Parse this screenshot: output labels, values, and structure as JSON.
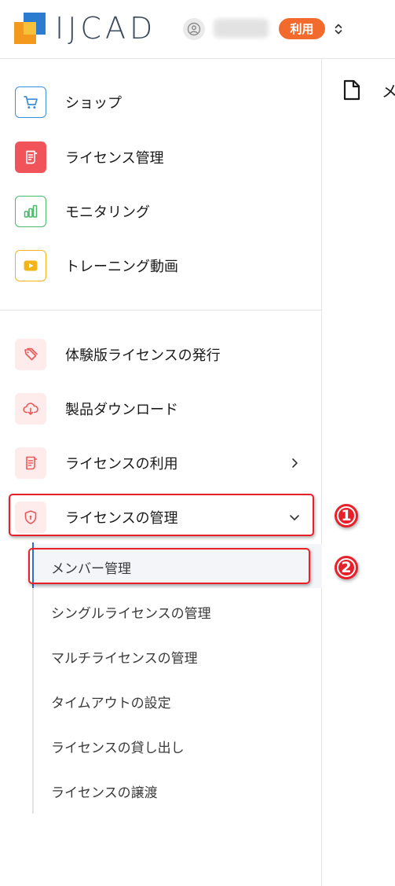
{
  "header": {
    "logo_text": "IJCAD",
    "badge": "利用",
    "logo_colors": {
      "blue": "#2b7bd0",
      "orange": "#f39a1e"
    }
  },
  "nav_primary": [
    {
      "label": "ショップ",
      "icon": "cart-icon"
    },
    {
      "label": "ライセンス管理",
      "icon": "document-icon"
    },
    {
      "label": "モニタリング",
      "icon": "bar-chart-icon"
    },
    {
      "label": "トレーニング動画",
      "icon": "play-icon"
    }
  ],
  "nav_secondary": [
    {
      "label": "体験版ライセンスの発行",
      "icon": "tags-icon"
    },
    {
      "label": "製品ダウンロード",
      "icon": "cloud-download-icon"
    },
    {
      "label": "ライセンスの利用",
      "icon": "document-icon"
    },
    {
      "label": "ライセンスの管理",
      "icon": "shield-icon",
      "expanded": true
    }
  ],
  "sub_items": [
    {
      "label": "メンバー管理",
      "active": true
    },
    {
      "label": "シングルライセンスの管理"
    },
    {
      "label": "マルチライセンスの管理"
    },
    {
      "label": "タイムアウトの設定"
    },
    {
      "label": "ライセンスの貸し出し"
    },
    {
      "label": "ライセンスの譲渡"
    }
  ],
  "annotations": {
    "marker1": "1",
    "marker2": "2"
  },
  "main": {
    "title": "メ"
  },
  "colors": {
    "accent": "#2f6fd1",
    "badge": "#f36b2c",
    "annotation": "#e8202a"
  }
}
